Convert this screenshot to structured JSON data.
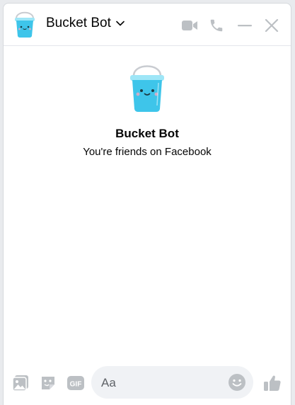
{
  "header": {
    "title": "Bucket Bot",
    "avatar_icon": "bucket-bot-avatar",
    "actions": [
      "video-call-icon",
      "phone-icon",
      "minimize-icon",
      "close-icon"
    ]
  },
  "profile": {
    "name": "Bucket Bot",
    "subtitle": "You're friends on Facebook"
  },
  "composer": {
    "placeholder": "Aa",
    "icons": [
      "photo-icon",
      "sticker-icon",
      "gif-icon",
      "emoji-icon",
      "thumbs-up-icon"
    ]
  },
  "colors": {
    "icon_gray": "#bcc0c4",
    "bucket_blue": "#3ec5ea",
    "bucket_rim": "#9ee6f7",
    "input_bg": "#f0f2f5"
  }
}
